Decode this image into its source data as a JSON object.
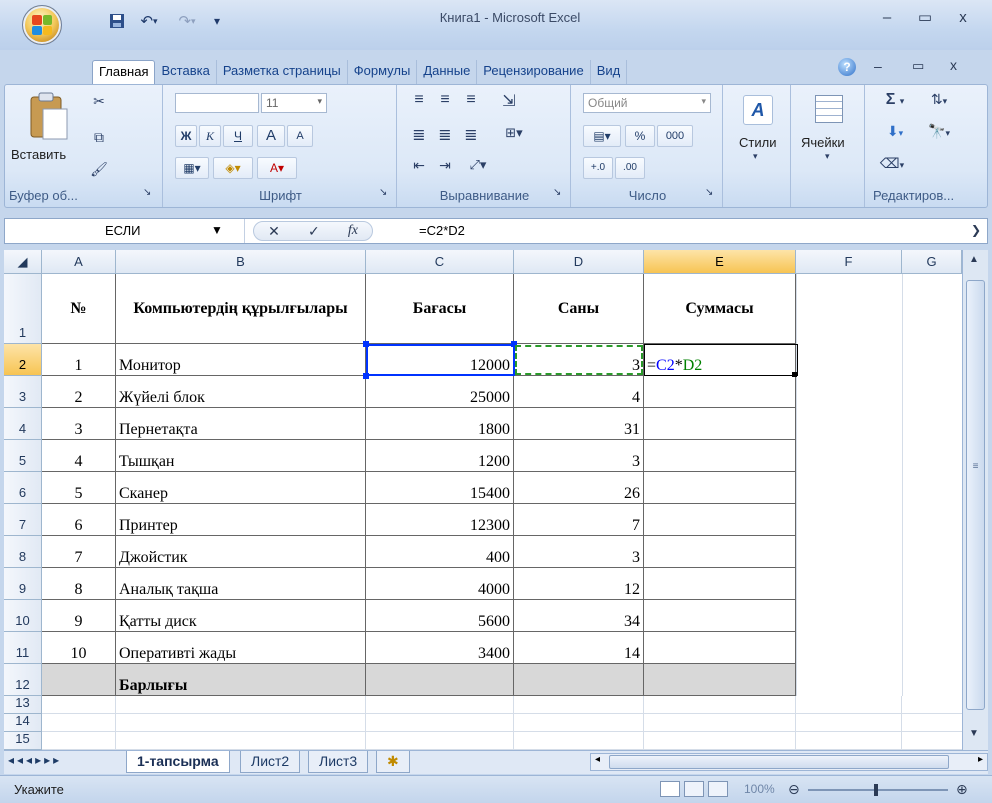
{
  "window": {
    "title": "Книга1 - Microsoft Excel",
    "minimize": "–",
    "restore": "▭",
    "close": "x"
  },
  "ribbon_tabs": [
    "Главная",
    "Вставка",
    "Разметка страницы",
    "Формулы",
    "Данные",
    "Рецензирование",
    "Вид"
  ],
  "ribbon": {
    "clipboard": {
      "paste_label": "Вставить",
      "group_label": "Буфер об...",
      "paste_icon": "clipboard-icon"
    },
    "font": {
      "size": "11",
      "bold": "Ж",
      "italic": "К",
      "underline": "Ч",
      "grow": "A",
      "shrink": "A",
      "group_label": "Шрифт"
    },
    "alignment": {
      "group_label": "Выравнивание"
    },
    "number": {
      "format": "Общий",
      "percent": "%",
      "thousands": "000",
      "group_label": "Число"
    },
    "styles": {
      "label": "Стили"
    },
    "cells": {
      "label": "Ячейки"
    },
    "editing": {
      "group_label": "Редактиров..."
    }
  },
  "formula_bar": {
    "name_box": "ЕСЛИ",
    "fx": "fx",
    "formula": "=C2*D2"
  },
  "columns": [
    "A",
    "B",
    "C",
    "D",
    "E",
    "F",
    "G"
  ],
  "rows": [
    "1",
    "2",
    "3",
    "4",
    "5",
    "6",
    "7",
    "8",
    "9",
    "10",
    "11",
    "12",
    "13",
    "14",
    "15"
  ],
  "table": {
    "headers": [
      "№",
      "Компьютердің құрылғылары",
      "Бағасы",
      "Саны",
      "Суммасы"
    ],
    "rows": [
      [
        "1",
        "Монитор",
        "12000",
        "3"
      ],
      [
        "2",
        "Жүйелі блок",
        "25000",
        "4"
      ],
      [
        "3",
        "Пернетақта",
        "1800",
        "31"
      ],
      [
        "4",
        "Тышқан",
        "1200",
        "3"
      ],
      [
        "5",
        "Сканер",
        "15400",
        "26"
      ],
      [
        "6",
        "Принтер",
        "12300",
        "7"
      ],
      [
        "7",
        "Джойстик",
        "400",
        "3"
      ],
      [
        "8",
        "Аналық тақша",
        "4000",
        "12"
      ],
      [
        "9",
        "Қатты диск",
        "5600",
        "34"
      ],
      [
        "10",
        "Оперативті жады",
        "3400",
        "14"
      ]
    ],
    "total_label": "Барлығы",
    "editing_cell": {
      "eq": "=",
      "ref1": "C2",
      "op": "*",
      "ref2": "D2"
    }
  },
  "sheet_tabs": [
    "1-тапсырма",
    "Лист2",
    "Лист3"
  ],
  "status": {
    "mode": "Укажите",
    "zoom": "100%"
  },
  "colors": {
    "ref_blue": "#0000ff",
    "ref_green": "#008000",
    "selected_header": "#f7c453",
    "total_row": "#d8d8d8"
  }
}
